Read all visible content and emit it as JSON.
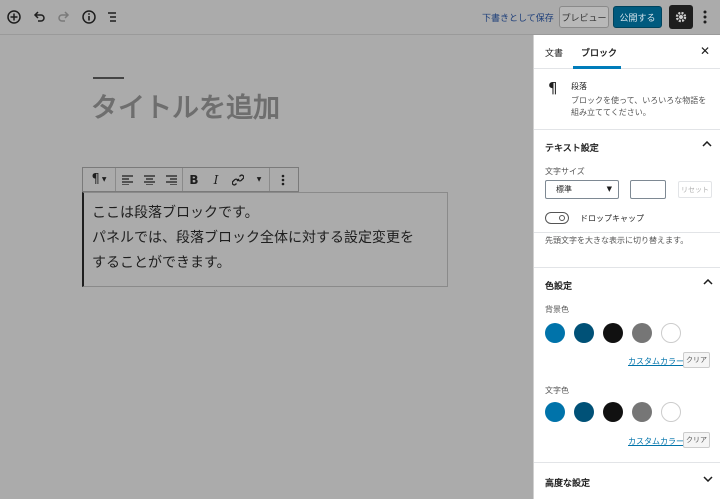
{
  "topbar": {
    "save_draft": "下書きとして保存",
    "preview": "プレビュー",
    "publish": "公開する"
  },
  "editor": {
    "title_placeholder": "タイトルを追加",
    "paragraph_lines": [
      "ここは段落ブロックです。",
      "パネルでは、段落ブロック全体に対する設定変更を",
      "することができます。"
    ]
  },
  "sidebar": {
    "tabs": [
      "文書",
      "ブロック"
    ],
    "block": {
      "name": "段落",
      "description": "ブロックを使って、いろいろな物語を組み立ててください。"
    },
    "text_settings": {
      "title": "テキスト設定",
      "font_size_label": "文字サイズ",
      "font_size_value": "標準",
      "reset": "リセット",
      "drop_cap_label": "ドロップキャップ",
      "drop_cap_help": "先頭文字を大きな表示に切り替えます。"
    },
    "color_settings": {
      "title": "色設定",
      "background_label": "背景色",
      "text_label": "文字色",
      "custom_color": "カスタムカラー",
      "clear": "クリア",
      "swatches": [
        "#0073aa",
        "#005177",
        "#111111",
        "#767676",
        "#ffffff"
      ]
    },
    "advanced": {
      "title": "高度な設定"
    }
  }
}
